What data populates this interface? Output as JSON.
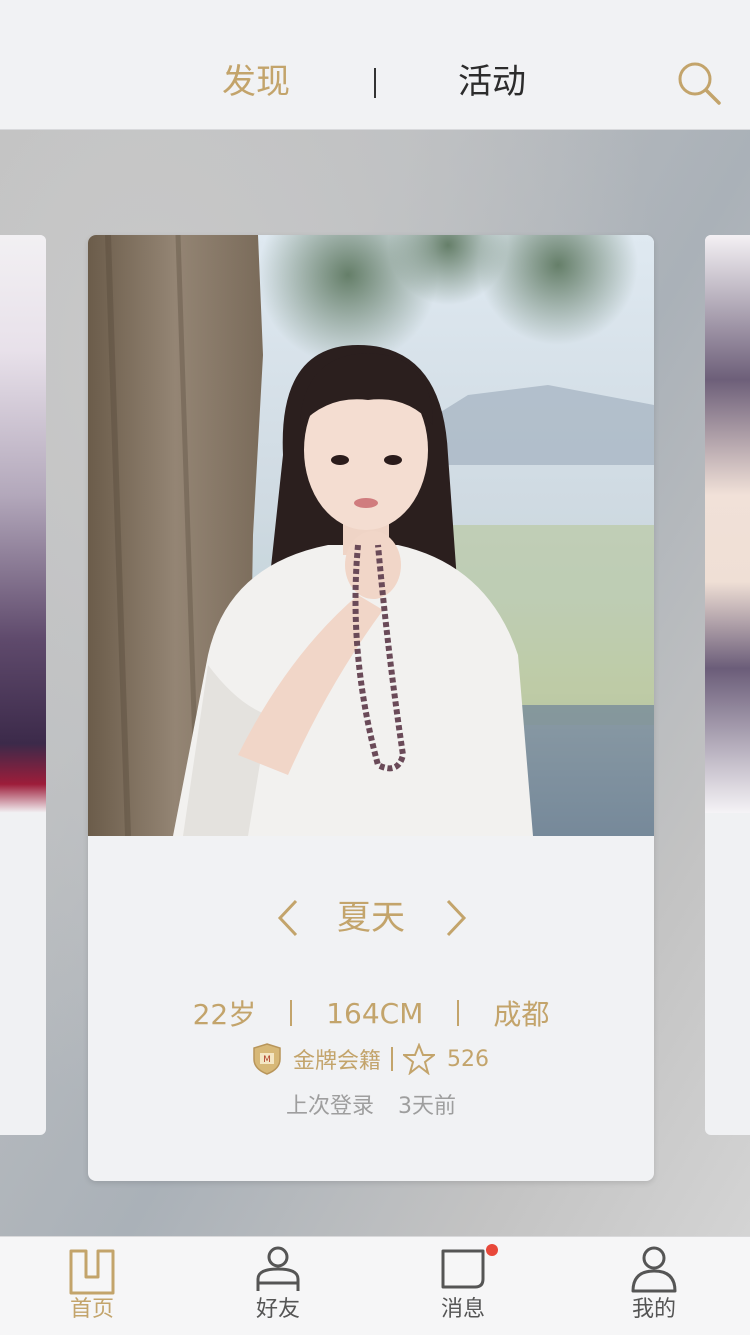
{
  "header": {
    "tabs": [
      {
        "label": "发现",
        "active": true
      },
      {
        "label": "活动",
        "active": false
      }
    ],
    "search_icon": "search-icon"
  },
  "profile": {
    "name": "夏天",
    "age": "22岁",
    "height": "164CM",
    "city": "成都",
    "membership": "金牌会籍",
    "stars": "526",
    "last_login_label": "上次登录",
    "last_login_value": "3天前"
  },
  "bottom_nav": [
    {
      "label": "首页",
      "icon": "home-icon",
      "active": true
    },
    {
      "label": "好友",
      "icon": "friends-icon",
      "active": false
    },
    {
      "label": "消息",
      "icon": "message-icon",
      "active": false,
      "has_badge": true
    },
    {
      "label": "我的",
      "icon": "profile-icon",
      "active": false
    }
  ],
  "colors": {
    "accent": "#c3a46b",
    "text_dark": "#2c2c2c",
    "text_muted": "#9e9e9e",
    "badge": "#e8483a"
  }
}
